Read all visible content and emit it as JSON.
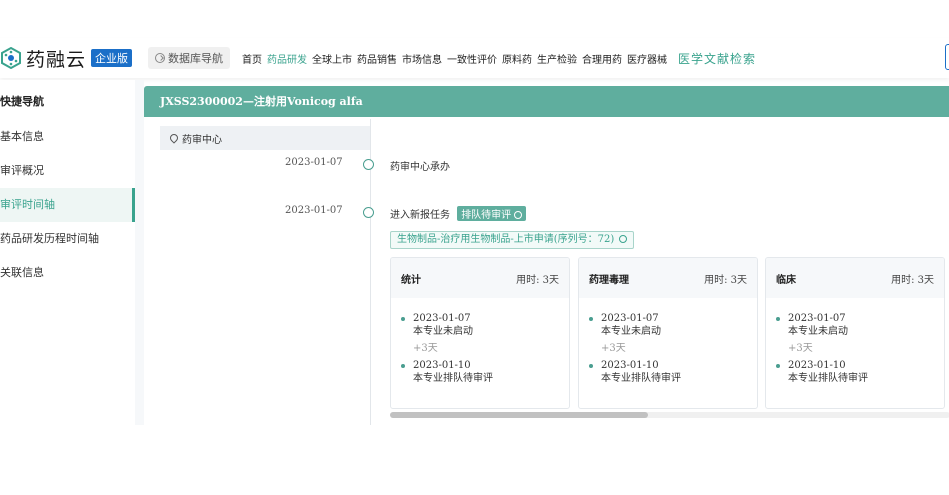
{
  "header": {
    "logo_text": "药融云",
    "edition": "企业版",
    "db_nav": "数据库导航",
    "nav_items": [
      "首页",
      "药品研发",
      "全球上市",
      "药品销售",
      "市场信息",
      "一致性评价",
      "原料药",
      "生产检验",
      "合理用药",
      "医疗器械"
    ],
    "active_nav": "药品研发",
    "literature_search": "医学文献检索"
  },
  "sidebar": {
    "title": "快捷导航",
    "items": [
      "基本信息",
      "审评概况",
      "审评时间轴",
      "药品研发历程时间轴",
      "关联信息"
    ],
    "active": "审评时间轴"
  },
  "main": {
    "heading": "JXSS2300002—注射用Vonicog alfa",
    "center": "药审中心",
    "events": [
      {
        "date": "2023-01-07",
        "text": "药审中心承办"
      },
      {
        "date": "2023-01-07",
        "text": "进入新报任务",
        "badge": "排队待审评"
      }
    ],
    "category": "生物制品-治疗用生物制品-上市申请(序列号：72)",
    "cards": [
      {
        "name": "统计",
        "duration": "用时: 3天",
        "start_date": "2023-01-07",
        "start_text": "本专业未启动",
        "gap": "+3天",
        "end_date": "2023-01-10",
        "end_text": "本专业排队待审评"
      },
      {
        "name": "药理毒理",
        "duration": "用时: 3天",
        "start_date": "2023-01-07",
        "start_text": "本专业未启动",
        "gap": "+3天",
        "end_date": "2023-01-10",
        "end_text": "本专业排队待审评"
      },
      {
        "name": "临床",
        "duration": "用时: 3天",
        "start_date": "2023-01-07",
        "start_text": "本专业未启动",
        "gap": "+3天",
        "end_date": "2023-01-10",
        "end_text": "本专业排队待审评"
      }
    ]
  },
  "colors": {
    "accent": "#5fae9e",
    "brand_blue": "#1b6fc8"
  }
}
